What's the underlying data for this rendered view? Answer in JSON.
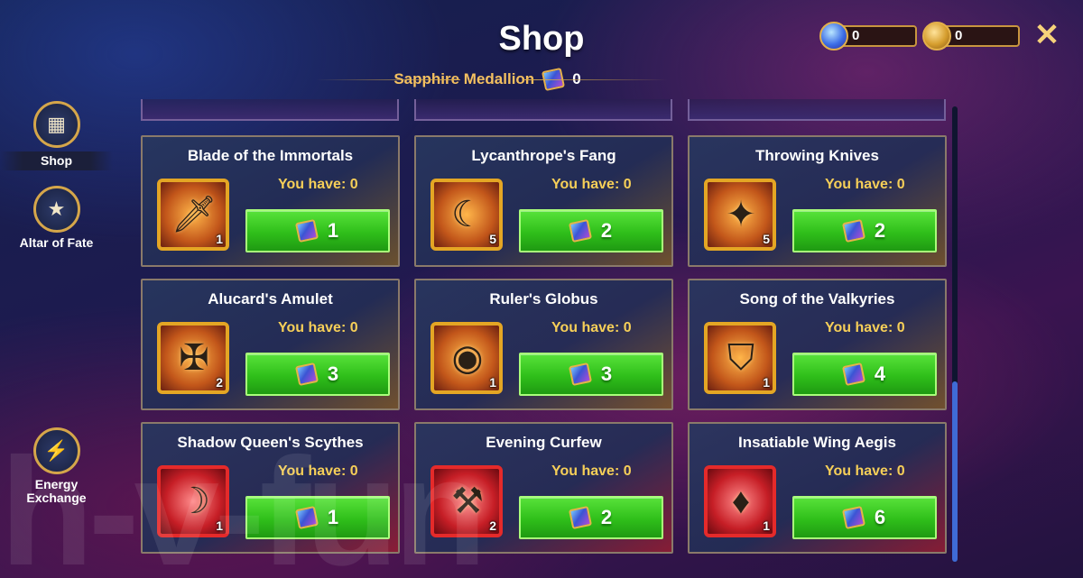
{
  "header": {
    "title": "Shop",
    "currency_name": "Sapphire Medallion",
    "currency_value": "0",
    "resource_1_value": "0",
    "resource_2_value": "0",
    "close_symbol": "✕"
  },
  "sidebar": {
    "items": [
      {
        "label": "Shop",
        "icon": "shop-icon"
      },
      {
        "label": "Altar of Fate",
        "icon": "star-pentagon-icon"
      },
      {
        "label": "Energy Exchange",
        "icon": "energy-exchange-icon"
      }
    ]
  },
  "items": [
    {
      "name": "Blade of the Immortals",
      "have": "You have: 0",
      "qty": "1",
      "price": "1",
      "frame": "gold"
    },
    {
      "name": "Lycanthrope's Fang",
      "have": "You have: 0",
      "qty": "5",
      "price": "2",
      "frame": "gold"
    },
    {
      "name": "Throwing Knives",
      "have": "You have: 0",
      "qty": "5",
      "price": "2",
      "frame": "gold"
    },
    {
      "name": "Alucard's Amulet",
      "have": "You have: 0",
      "qty": "2",
      "price": "3",
      "frame": "gold"
    },
    {
      "name": "Ruler's Globus",
      "have": "You have: 0",
      "qty": "1",
      "price": "3",
      "frame": "gold"
    },
    {
      "name": "Song of the Valkyries",
      "have": "You have: 0",
      "qty": "1",
      "price": "4",
      "frame": "gold"
    },
    {
      "name": "Shadow Queen's Scythes",
      "have": "You have: 0",
      "qty": "1",
      "price": "1",
      "frame": "red"
    },
    {
      "name": "Evening Curfew",
      "have": "You have: 0",
      "qty": "2",
      "price": "2",
      "frame": "red"
    },
    {
      "name": "Insatiable Wing Aegis",
      "have": "You have: 0",
      "qty": "1",
      "price": "6",
      "frame": "red"
    }
  ],
  "watermark": "h-v-fun",
  "colors": {
    "buy_green": "#2fbf1a",
    "gold_frame": "#e4a624",
    "red_frame": "#e52a2a",
    "label_gold": "#f6cf58"
  }
}
